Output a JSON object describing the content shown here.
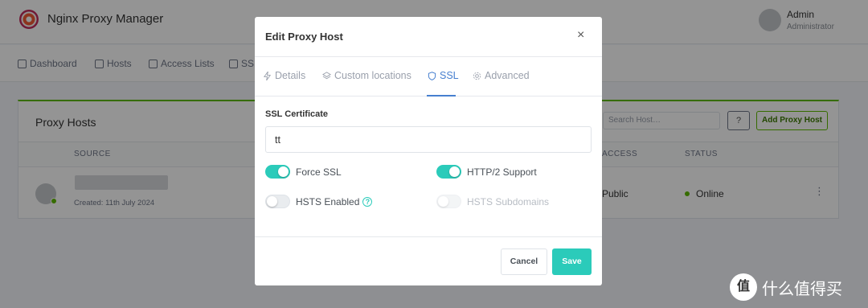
{
  "app": {
    "title": "Nginx Proxy Manager",
    "user_name": "Admin",
    "user_role": "Administrator"
  },
  "nav": {
    "items": [
      {
        "label": "Dashboard",
        "icon": "home-icon"
      },
      {
        "label": "Hosts",
        "icon": "monitor-icon"
      },
      {
        "label": "Access Lists",
        "icon": "lock-icon"
      },
      {
        "label": "SSL",
        "icon": "shield-icon"
      }
    ]
  },
  "card": {
    "title": "Proxy Hosts",
    "search_placeholder": "Search Host…",
    "help_label": "?",
    "add_label": "Add Proxy Host",
    "columns": {
      "source": "SOURCE",
      "access": "ACCESS",
      "status": "STATUS"
    },
    "row": {
      "created": "Created: 11th July 2024",
      "access": "Public",
      "status": "Online",
      "menu": "⋮"
    }
  },
  "modal": {
    "title": "Edit Proxy Host",
    "close": "×",
    "tabs": [
      {
        "label": "Details",
        "icon": "bolt-icon",
        "active": false
      },
      {
        "label": "Custom locations",
        "icon": "layers-icon",
        "active": false
      },
      {
        "label": "SSL",
        "icon": "shield-icon",
        "active": true
      },
      {
        "label": "Advanced",
        "icon": "gear-icon",
        "active": false
      }
    ],
    "ssl_label": "SSL Certificate",
    "ssl_value": "tt",
    "toggles": {
      "force_ssl": {
        "label": "Force SSL",
        "on": true
      },
      "http2": {
        "label": "HTTP/2 Support",
        "on": true
      },
      "hsts": {
        "label": "HSTS Enabled",
        "on": false
      },
      "hsts_sub": {
        "label": "HSTS Subdomains",
        "on": false,
        "disabled": true
      }
    },
    "help_icon": "?",
    "cancel_label": "Cancel",
    "save_label": "Save"
  },
  "watermark": {
    "badge": "值",
    "text": "什么值得买"
  },
  "colors": {
    "accent": "#2bcbba",
    "tab_active": "#467fcf",
    "online": "#5eba00"
  }
}
